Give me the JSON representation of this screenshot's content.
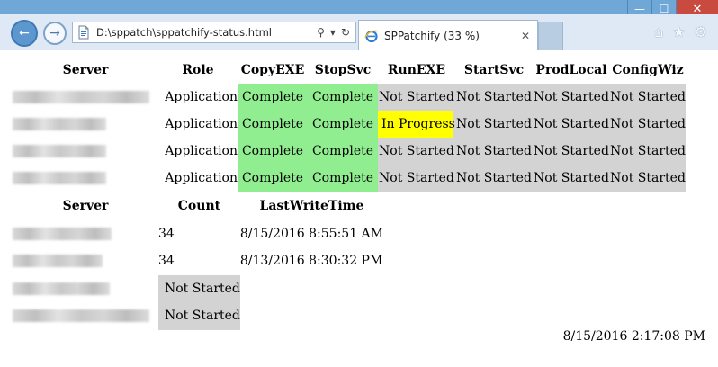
{
  "browser": {
    "caption": {
      "minimize": "—",
      "maximize": "☐",
      "close": "✕"
    },
    "back_glyph": "←",
    "forward_glyph": "→",
    "address": {
      "url": "D:\\sppatch\\sppatchify-status.html",
      "search_glyph": "⚲",
      "dropdown_glyph": "▾",
      "refresh_glyph": "↻"
    },
    "tab": {
      "title": "SPPatchify (33 %)",
      "close_glyph": "✕"
    },
    "icons": {
      "home": "⌂",
      "favorites": "★",
      "settings": "⚙"
    },
    "accent_color": "#6fa8d6"
  },
  "status_table": {
    "headers": [
      "Server",
      "Role",
      "CopyEXE",
      "StopSvc",
      "RunEXE",
      "StartSvc",
      "ProdLocal",
      "ConfigWiz"
    ],
    "rows": [
      {
        "server_redacted": true,
        "role": "Application",
        "copyexe": "Complete",
        "stopsvc": "Complete",
        "runexe": "Not Started",
        "startsvc": "Not Started",
        "prodlocal": "Not Started",
        "configwiz": "Not Started"
      },
      {
        "server_redacted": true,
        "role": "Application",
        "copyexe": "Complete",
        "stopsvc": "Complete",
        "runexe": "In Progress",
        "startsvc": "Not Started",
        "prodlocal": "Not Started",
        "configwiz": "Not Started"
      },
      {
        "server_redacted": true,
        "role": "Application",
        "copyexe": "Complete",
        "stopsvc": "Complete",
        "runexe": "Not Started",
        "startsvc": "Not Started",
        "prodlocal": "Not Started",
        "configwiz": "Not Started"
      },
      {
        "server_redacted": true,
        "role": "Application",
        "copyexe": "Complete",
        "stopsvc": "Complete",
        "runexe": "Not Started",
        "startsvc": "Not Started",
        "prodlocal": "Not Started",
        "configwiz": "Not Started"
      }
    ]
  },
  "files_table": {
    "headers": [
      "Server",
      "Count",
      "LastWriteTime"
    ],
    "rows": [
      {
        "server_redacted": true,
        "count": "34",
        "last_write_time": "8/15/2016 8:55:51 AM"
      },
      {
        "server_redacted": true,
        "count": "34",
        "last_write_time": "8/13/2016 8:30:32 PM"
      },
      {
        "server_redacted": true,
        "count": "Not Started",
        "last_write_time": ""
      },
      {
        "server_redacted": true,
        "count": "Not Started",
        "last_write_time": ""
      }
    ]
  },
  "footer_timestamp": "8/15/2016 2:17:08 PM",
  "status_colors": {
    "complete": "#90ee90",
    "not_started": "#d3d3d3",
    "in_progress": "#ffff00"
  }
}
